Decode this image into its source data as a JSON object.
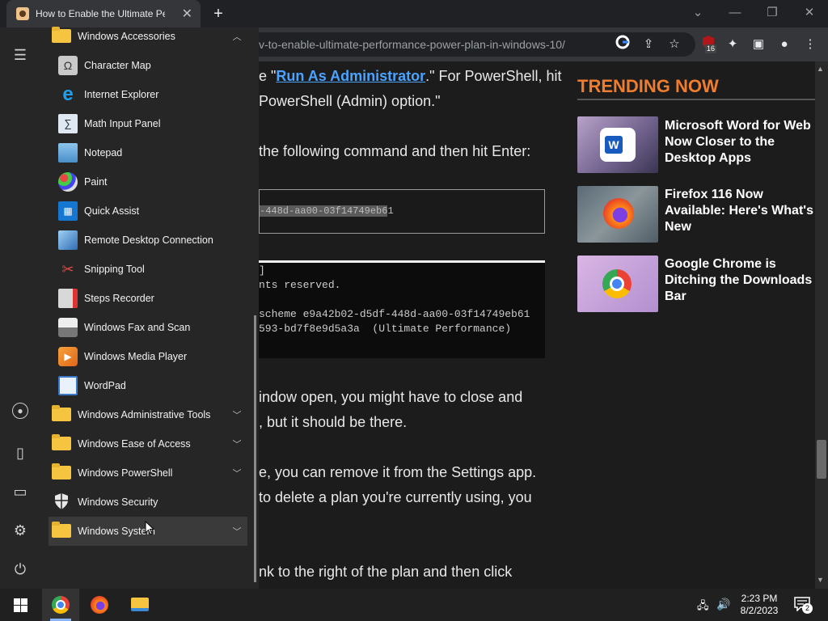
{
  "browser": {
    "tab_title": "How to Enable the Ultimate Performance",
    "url": "v-to-enable-ultimate-performance-power-plan-in-windows-10/",
    "extension_badge": "16"
  },
  "article": {
    "line1_pre": "e \"",
    "line1_link": "Run As Administrator",
    "line1_post": ".\" For PowerShell, hit",
    "line2": "PowerShell (Admin) option.\"",
    "line3": "the following command and then hit Enter:",
    "code": "-448d-aa00-03f14749eb61",
    "code_highlight": "-448d-aa00-03f14749eb6",
    "code_tail": "1",
    "terminal": [
      "]",
      "nts reserved.",
      "",
      "scheme e9a42b02-d5df-448d-aa00-03f14749eb61",
      "593-bd7f8e9d5a3a  (Ultimate Performance)"
    ],
    "line4": "indow open, you might have to close and",
    "line5": ", but it should be there.",
    "line6": "e, you can remove it from the Settings app.",
    "line7": " to delete a plan you're currently using, you",
    "line8": "nk to the right of the plan and then click"
  },
  "trending": {
    "heading": "TRENDING NOW",
    "items": [
      {
        "title": "Microsoft Word for Web Is Now Closer to the Desktop Apps"
      },
      {
        "title": "Firefox 116 Now Available: Here's What's New"
      },
      {
        "title": "Google Chrome is Ditching the Downloads Bar"
      }
    ]
  },
  "start_menu": {
    "items": [
      {
        "label": "Windows Accessories",
        "icon": "folder-icon",
        "expanded": true
      },
      {
        "label": "Character Map",
        "icon": "character-map-icon"
      },
      {
        "label": "Internet Explorer",
        "icon": "internet-explorer-icon"
      },
      {
        "label": "Math Input Panel",
        "icon": "math-input-icon"
      },
      {
        "label": "Notepad",
        "icon": "notepad-icon"
      },
      {
        "label": "Paint",
        "icon": "paint-icon"
      },
      {
        "label": "Quick Assist",
        "icon": "quick-assist-icon"
      },
      {
        "label": "Remote Desktop Connection",
        "icon": "remote-desktop-icon"
      },
      {
        "label": "Snipping Tool",
        "icon": "snipping-tool-icon"
      },
      {
        "label": "Steps Recorder",
        "icon": "steps-recorder-icon"
      },
      {
        "label": "Windows Fax and Scan",
        "icon": "fax-icon"
      },
      {
        "label": "Windows Media Player",
        "icon": "media-player-icon"
      },
      {
        "label": "WordPad",
        "icon": "wordpad-icon"
      },
      {
        "label": "Windows Administrative Tools",
        "icon": "folder-icon"
      },
      {
        "label": "Windows Ease of Access",
        "icon": "folder-icon"
      },
      {
        "label": "Windows PowerShell",
        "icon": "folder-icon"
      },
      {
        "label": "Windows Security",
        "icon": "shield-icon"
      },
      {
        "label": "Windows System",
        "icon": "folder-icon"
      }
    ]
  },
  "taskbar": {
    "time": "2:23 PM",
    "date": "8/2/2023",
    "notifications": "2"
  },
  "colors": {
    "accent": "#f07c2e",
    "link": "#4aa3ff",
    "folder": "#f5c542"
  }
}
